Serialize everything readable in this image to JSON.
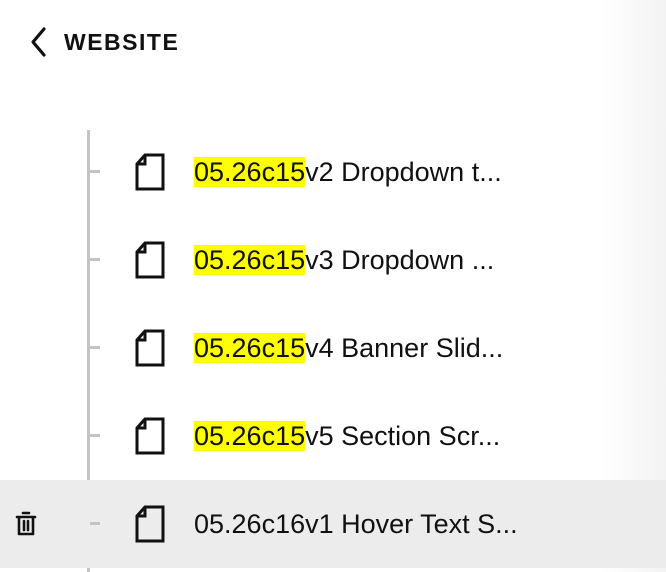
{
  "header": {
    "back_label": "WEBSITE",
    "back_icon": "chevron-left-icon"
  },
  "colors": {
    "highlight": "#ffff00",
    "selected_row_bg": "#ececec",
    "tree_line": "#c4c4c4"
  },
  "pages": [
    {
      "highlight": "05.26c15",
      "rest": "v2 Dropdown t...",
      "selected": false,
      "icon": "page-icon"
    },
    {
      "highlight": "05.26c15",
      "rest": "v3 Dropdown ...",
      "selected": false,
      "icon": "page-icon"
    },
    {
      "highlight": "05.26c15",
      "rest": "v4 Banner Slid...",
      "selected": false,
      "icon": "page-icon"
    },
    {
      "highlight": "05.26c15",
      "rest": "v5 Section Scr...",
      "selected": false,
      "icon": "page-icon"
    },
    {
      "highlight": "",
      "rest": "05.26c16v1 Hover Text S...",
      "selected": true,
      "icon": "page-icon",
      "action_icon": "trash-icon"
    }
  ]
}
